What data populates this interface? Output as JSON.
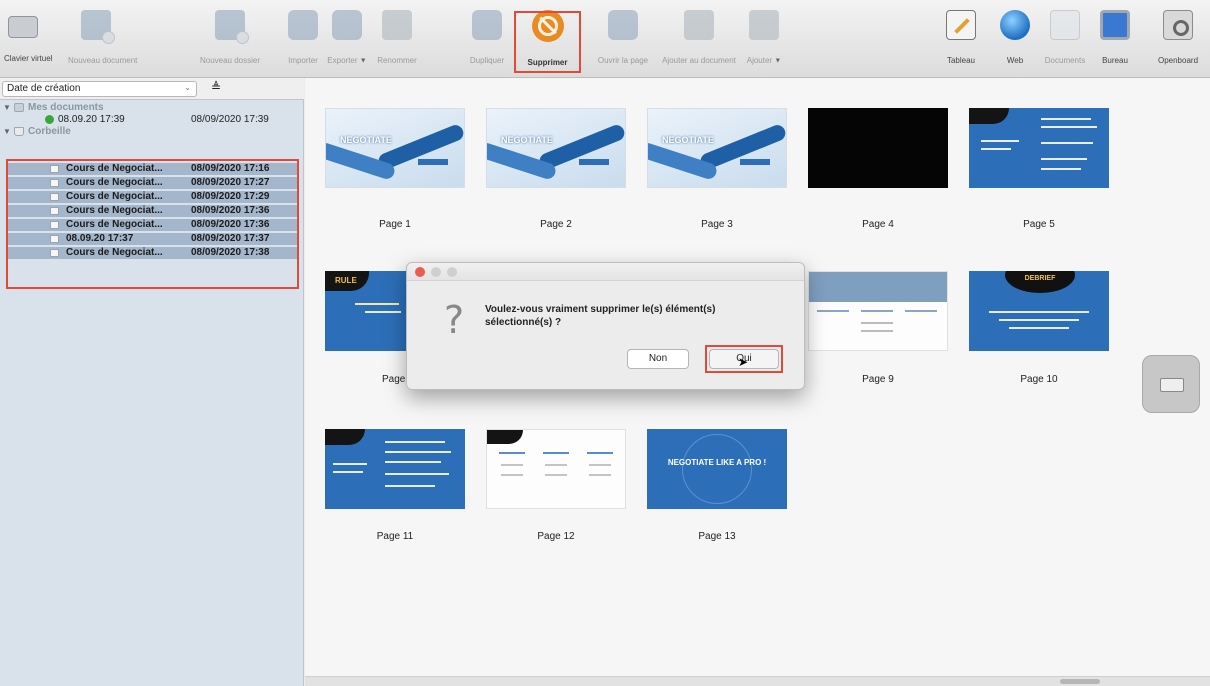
{
  "toolbar": {
    "items": [
      {
        "label": "Clavier virtuel",
        "icon": "keyboard-icon"
      },
      {
        "label": "Nouveau document",
        "icon": "new-document-icon"
      },
      {
        "label": "Nouveau dossier",
        "icon": "new-folder-icon"
      },
      {
        "label": "Importer",
        "icon": "import-icon"
      },
      {
        "label": "Exporter",
        "icon": "export-icon"
      },
      {
        "label": "Renommer",
        "icon": "rename-icon"
      },
      {
        "label": "Dupliquer",
        "icon": "duplicate-icon"
      },
      {
        "label": "Supprimer",
        "icon": "delete-icon"
      },
      {
        "label": "Ouvrir la page",
        "icon": "open-page-icon"
      },
      {
        "label": "Ajouter au document",
        "icon": "add-to-document-icon"
      },
      {
        "label": "Ajouter",
        "icon": "add-icon"
      },
      {
        "label": "Tableau",
        "icon": "board-icon"
      },
      {
        "label": "Web",
        "icon": "web-globe-icon"
      },
      {
        "label": "Documents",
        "icon": "documents-icon"
      },
      {
        "label": "Bureau",
        "icon": "desktop-icon"
      },
      {
        "label": "Openboard",
        "icon": "openboard-settings-icon"
      }
    ]
  },
  "sidebar": {
    "sort_label": "Date de création",
    "tree": {
      "mes_documents": "Mes documents",
      "doc1_name": "08.09.20 17:39",
      "doc1_date": "08/09/2020 17:39",
      "corbeille": "Corbeille"
    },
    "trash_items": [
      {
        "name": "Cours de Negociat...",
        "date": "08/09/2020 17:16"
      },
      {
        "name": "Cours de Negociat...",
        "date": "08/09/2020 17:27"
      },
      {
        "name": "Cours de Negociat...",
        "date": "08/09/2020 17:29"
      },
      {
        "name": "Cours de Negociat...",
        "date": "08/09/2020 17:36"
      },
      {
        "name": "Cours de Negociat...",
        "date": "08/09/2020 17:36"
      },
      {
        "name": "08.09.20 17:37",
        "date": "08/09/2020 17:37"
      },
      {
        "name": "Cours de Negociat...",
        "date": "08/09/2020 17:38"
      }
    ]
  },
  "pages": [
    {
      "label": "Page 1",
      "title": "NEGOTIATE"
    },
    {
      "label": "Page 2",
      "title": "NEGOTIATE"
    },
    {
      "label": "Page 3",
      "title": "NEGOTIATE"
    },
    {
      "label": "Page 4"
    },
    {
      "label": "Page 5"
    },
    {
      "label": "Page",
      "title": "RULE"
    },
    {
      "label": "Page 9"
    },
    {
      "label": "Page 10",
      "title": "DEBRIEF"
    },
    {
      "label": "Page 11"
    },
    {
      "label": "Page 12"
    },
    {
      "label": "Page 13",
      "title": "NEGOTIATE LIKE A PRO !"
    }
  ],
  "dialog": {
    "message": "Voulez-vous vraiment supprimer le(s) élément(s) sélectionné(s) ?",
    "no_label": "Non",
    "yes_label": "Oui"
  },
  "colors": {
    "highlight": "#e04a3b",
    "selection_row": "#a4b6cb",
    "slide_blue": "#2c6fb8",
    "delete_icon": "#e98a22"
  }
}
